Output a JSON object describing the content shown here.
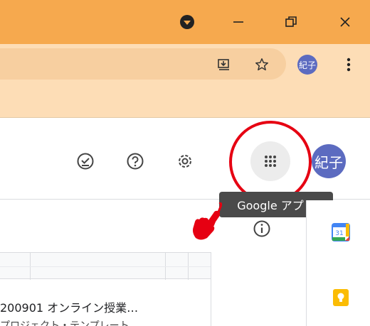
{
  "browser": {
    "profile_initials": "紀子",
    "icons": [
      "media-icon",
      "minimize-icon",
      "restore-icon",
      "close-icon",
      "install-icon",
      "star-icon",
      "more-vert-icon"
    ]
  },
  "header": {
    "icons": [
      "ready-offline-icon",
      "help-icon",
      "settings-icon",
      "google-apps-icon"
    ],
    "account_initials": "紀子",
    "tooltip": "Google アプリ"
  },
  "content": {
    "file_title": "200901 オンライン授業…",
    "file_sub": "プロジェクト・テンプレート",
    "info_icon": "info-icon"
  },
  "side_panel": {
    "apps": [
      "google-calendar-icon",
      "google-keep-icon"
    ]
  },
  "annotation": {
    "highlight_color": "#E60012"
  }
}
